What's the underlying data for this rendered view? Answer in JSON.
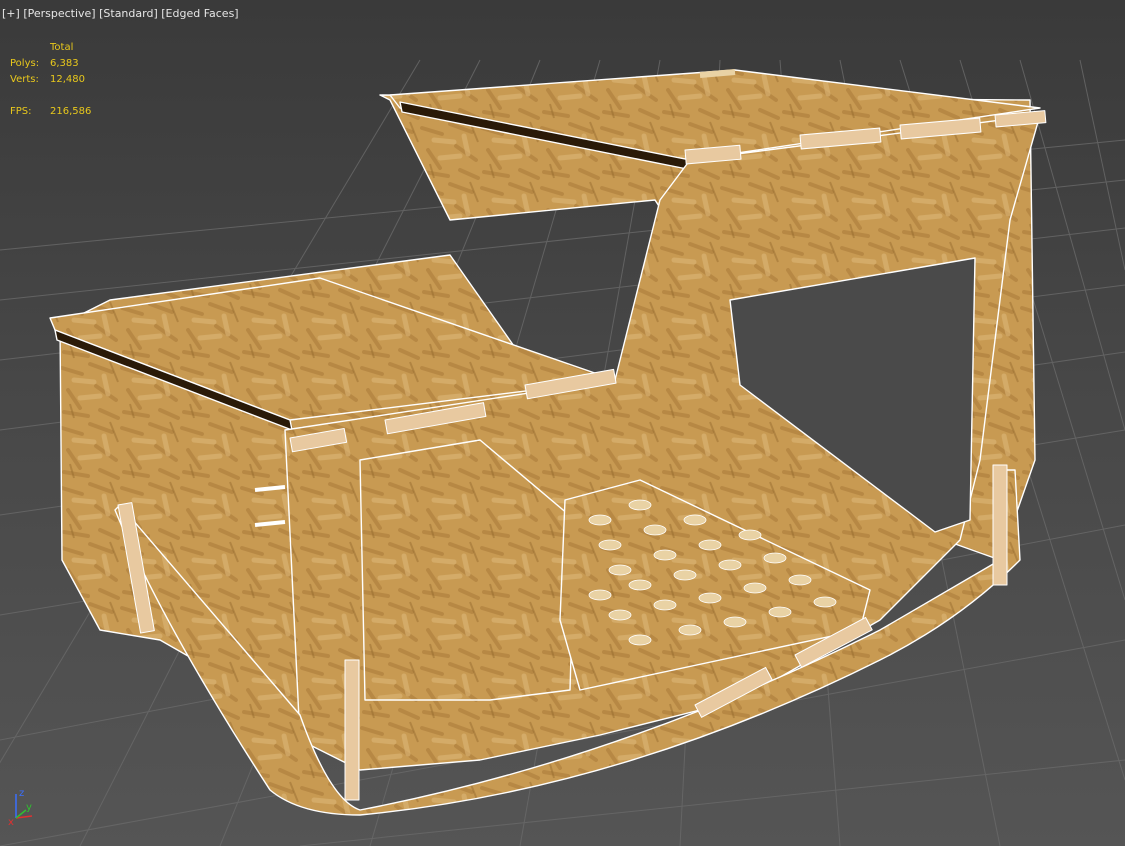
{
  "viewport": {
    "label_plus": "[+]",
    "label_view": "[Perspective]",
    "label_shading": "[Standard]",
    "label_edges": "[Edged Faces]"
  },
  "stats": {
    "header": "Total",
    "polys_label": "Polys:",
    "polys_value": "6,383",
    "verts_label": "Verts:",
    "verts_value": "12,480",
    "fps_label": "FPS:",
    "fps_value": "216,586"
  },
  "gizmo": {
    "x": "x",
    "y": "y",
    "z": "z"
  },
  "colors": {
    "wood": "#c89a52",
    "wood_dark": "#a97a38",
    "wood_light": "#dcb676",
    "edge": "#ffffff",
    "grid_line": "#6a6a6a",
    "text_yellow": "#e8c81c"
  },
  "icons": {
    "axis": "axis-gizmo-icon"
  }
}
